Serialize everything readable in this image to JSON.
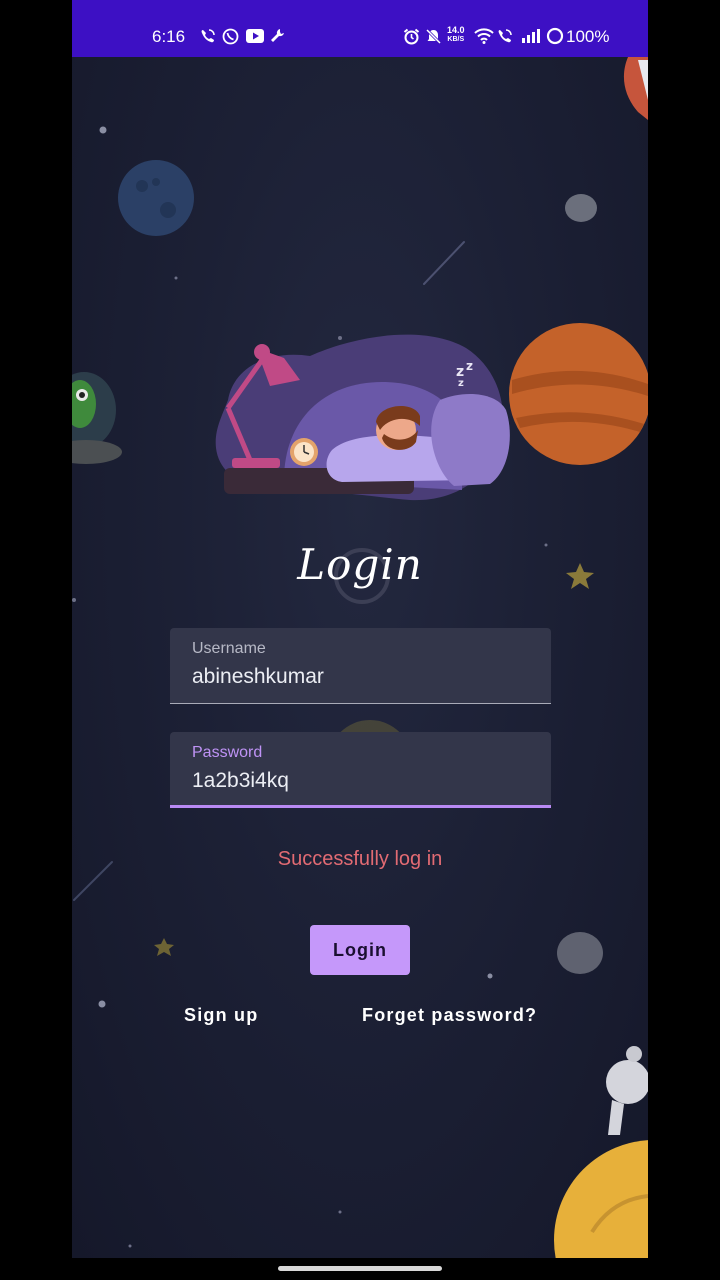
{
  "status_bar": {
    "time": "6:16",
    "net_speed_value": "14.0",
    "net_speed_unit": "KB/S",
    "battery": "100%",
    "left_icons": [
      "wifi-call-icon",
      "whatsapp-icon",
      "youtube-icon",
      "wrench-icon"
    ],
    "right_icons": [
      "alarm-icon",
      "mute-icon",
      "wifi-icon",
      "wifi-call-icon",
      "signal-icon",
      "battery-ring-icon"
    ]
  },
  "title": "Login",
  "username": {
    "label": "Username",
    "value": "abineshkumar"
  },
  "password": {
    "label": "Password",
    "value": "1a2b3i4kq"
  },
  "message": "Successfully log in",
  "login_button": "Login",
  "signup_link": "Sign up",
  "forget_link": "Forget password?",
  "colors": {
    "status_bar": "#3d10c4",
    "background": "#1c2035",
    "accent": "#c598fa",
    "message": "#e26b73"
  }
}
